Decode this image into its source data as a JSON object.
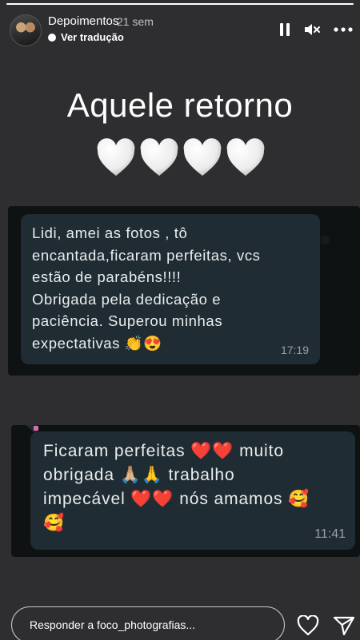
{
  "story": {
    "progress_fraction": 1.0,
    "username": "Depoimentos",
    "posted_ago": "21 sem",
    "translate_label": "Ver tradução",
    "title": "Aquele retorno",
    "hearts_count": 4
  },
  "messages": [
    {
      "text": "Lidi, amei as fotos ,  tô\nencantada,ficaram perfeitas, vcs\nestão de parabéns!!!!\nObrigada pela dedicação e\npaciência. Superou minhas\nexpectativas 👏😍",
      "time": "17:19"
    },
    {
      "text": "Ficaram perfeitas ❤️❤️ muito\nobrigada 🙏🏼🙏 trabalho\nimpecável ❤️❤️ nós amamos 🥰\n🥰",
      "time": "11:41"
    }
  ],
  "reply": {
    "placeholder": "Responder a foco_photografias..."
  },
  "icons": {
    "pause": "pause-icon",
    "mute": "mute-icon",
    "more": "more-icon",
    "like": "heart-icon",
    "send": "send-icon",
    "translate": "translate-dot-icon",
    "hearts": "white-heart-icon"
  },
  "colors": {
    "background": "#2e2e30",
    "bubble": "#1f2c33",
    "chat_panel": "#0f1213",
    "text": "#e9edef"
  }
}
